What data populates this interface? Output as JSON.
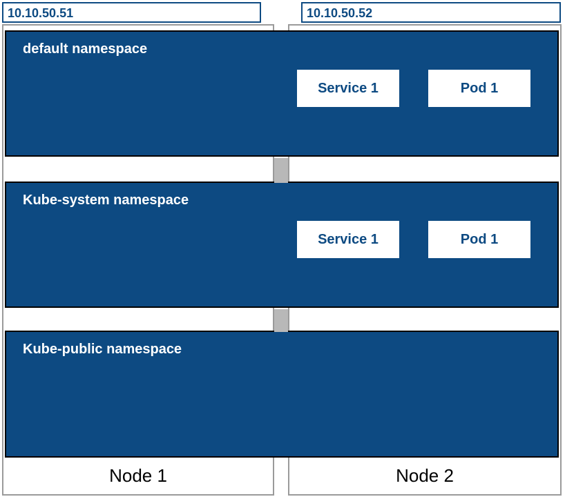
{
  "nodes": {
    "left": {
      "ip": "10.10.50.51",
      "label": "Node 1"
    },
    "right": {
      "ip": "10.10.50.52",
      "label": "Node 2"
    }
  },
  "namespaces": {
    "default": {
      "title": "default namespace",
      "service": "Service 1",
      "pod": "Pod 1"
    },
    "kube_system": {
      "title": "Kube-system namespace",
      "service": "Service 1",
      "pod": "Pod 1"
    },
    "kube_public": {
      "title": "Kube-public namespace"
    }
  }
}
